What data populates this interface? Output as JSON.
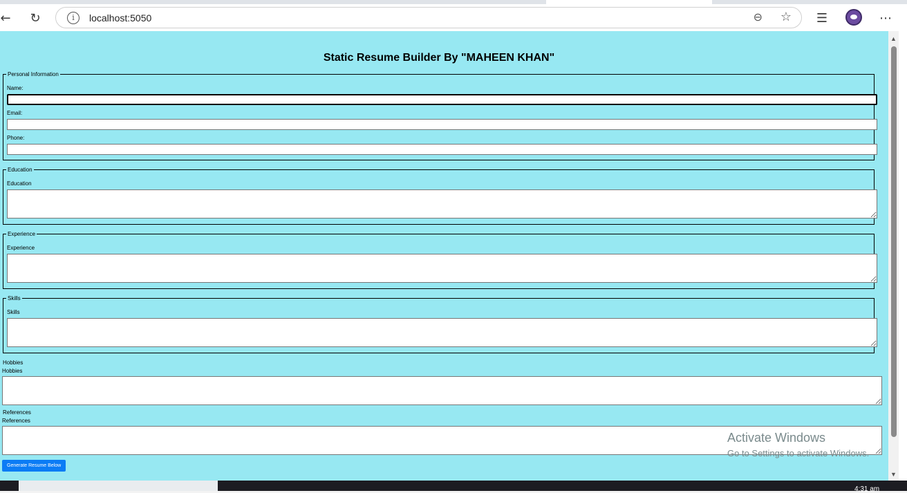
{
  "browser": {
    "url": "localhost:5050"
  },
  "page": {
    "title": "Static Resume Builder By \"MAHEEN KHAN\"",
    "personal": {
      "legend": "Personal Information",
      "name_label": "Name:",
      "email_label": "Email:",
      "phone_label": "Phone:"
    },
    "education": {
      "legend": "Education",
      "label": "Education"
    },
    "experience": {
      "legend": "Experience",
      "label": "Experience"
    },
    "skills": {
      "legend": "Skills",
      "label": "Skills"
    },
    "hobbies": {
      "heading": "Hobbies",
      "label": "Hobbies"
    },
    "references": {
      "heading": "References",
      "label": "References"
    },
    "generate_button": "Generate Resume Below"
  },
  "watermark": {
    "line1": "Activate Windows",
    "line2": "Go to Settings to activate Windows."
  },
  "taskbar": {
    "clock": "4:31 am"
  },
  "colors": {
    "page_background": "#97e8f2",
    "button": "#0b7cf5"
  }
}
